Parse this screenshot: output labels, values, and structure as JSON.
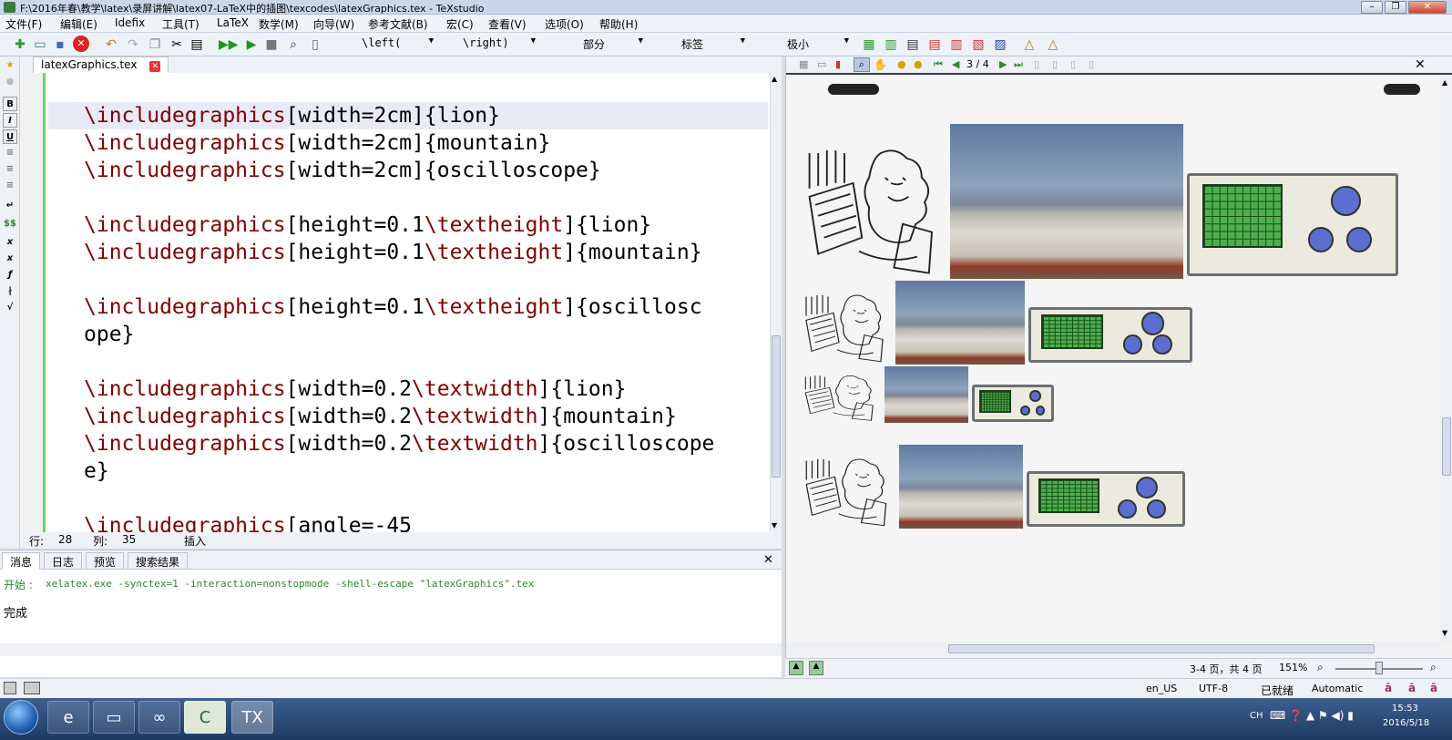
{
  "window": {
    "title": "F:\\2016年春\\教学\\latex\\录屏讲解\\latex07-LaTeX中的插图\\texcodes\\latexGraphics.tex - TeXstudio"
  },
  "menu": [
    "文件(F)",
    "编辑(E)",
    "Idefix",
    "工具(T)",
    "LaTeX",
    "数学(M)",
    "向导(W)",
    "参考文献(B)",
    "宏(C)",
    "查看(V)",
    "选项(O)",
    "帮助(H)"
  ],
  "toolbar": {
    "left_combo": "\\left(",
    "right_combo": "\\right)",
    "part_combo": "部分",
    "label_combo": "标签",
    "size_combo": "极小"
  },
  "editor": {
    "tab_label": "latexGraphics.tex",
    "lines": [
      {
        "cmd": "\\includegraphics",
        "rest": "[width=2cm]{lion}"
      },
      {
        "cmd": "\\includegraphics",
        "rest": "[width=2cm]{mountain}"
      },
      {
        "cmd": "\\includegraphics",
        "rest": "[width=2cm]{oscilloscope}"
      },
      {
        "cmd": "",
        "rest": ""
      },
      {
        "cmd": "\\includegraphics",
        "rest": "[height=0.1",
        "cmd2": "\\textheight",
        "rest2": "]{lion}"
      },
      {
        "cmd": "\\includegraphics",
        "rest": "[height=0.1",
        "cmd2": "\\textheight",
        "rest2": "]{mountain}"
      },
      {
        "cmd": "",
        "rest": ""
      },
      {
        "cmd": "\\includegraphics",
        "rest": "[height=0.1",
        "cmd2": "\\textheight",
        "rest2": "]{oscillosc"
      },
      {
        "cmd": "",
        "rest": "ope}"
      },
      {
        "cmd": "",
        "rest": ""
      },
      {
        "cmd": "\\includegraphics",
        "rest": "[width=0.2",
        "cmd2": "\\textwidth",
        "rest2": "]{lion}"
      },
      {
        "cmd": "\\includegraphics",
        "rest": "[width=0.2",
        "cmd2": "\\textwidth",
        "rest2": "]{mountain}"
      },
      {
        "cmd": "\\includegraphics",
        "rest": "[width=0.2",
        "cmd2": "\\textwidth",
        "rest2": "]{oscilloscope"
      },
      {
        "cmd": "",
        "rest": "e}"
      },
      {
        "cmd": "",
        "rest": ""
      },
      {
        "cmd": "\\includegraphics",
        "rest": "[angle=-45"
      }
    ],
    "status_row_label": "行:",
    "status_row": "28",
    "status_col_label": "列:",
    "status_col": "35",
    "status_mode": "插入"
  },
  "messages": {
    "tabs": [
      "消息",
      "日志",
      "预览",
      "搜索结果"
    ],
    "start_label": "开始 :",
    "command": "xelatex.exe -synctex=1 -interaction=nonstopmode -shell-escape \"latexGraphics\".tex",
    "done": "完成"
  },
  "pdf": {
    "page_indicator": "3 / 4",
    "pages_info": "3-4 页，共 4 页",
    "zoom": "151%"
  },
  "statusbar": {
    "lang": "en_US",
    "encoding": "UTF-8",
    "state": "已就绪",
    "mode": "Automatic"
  },
  "taskbar": {
    "lang": "CH",
    "time": "15:53",
    "date": "2016/5/18"
  },
  "colors": {
    "accent_green": "#6ad36a",
    "command_red": "#800000",
    "taskbar": "#2a4a78"
  }
}
